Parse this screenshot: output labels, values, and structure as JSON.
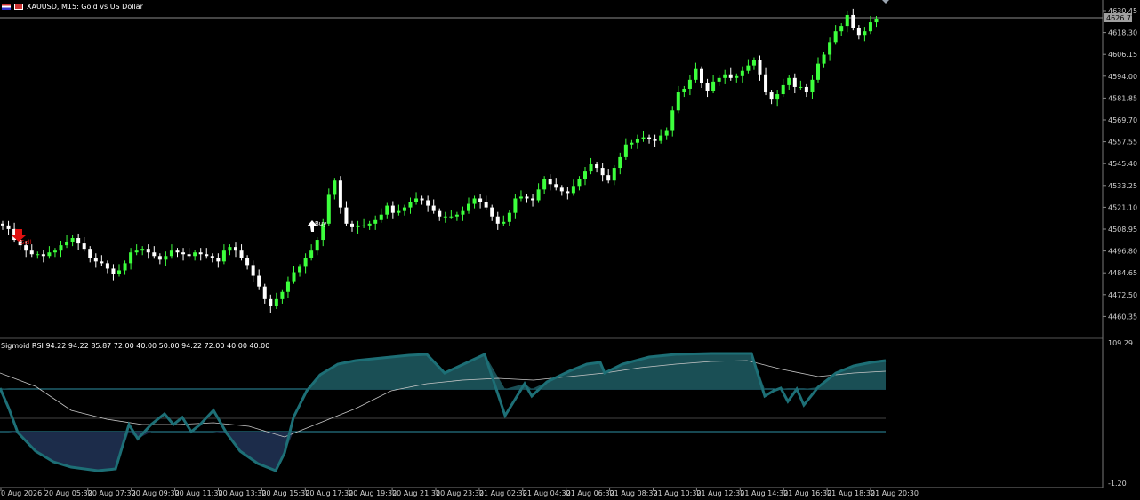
{
  "header": {
    "symbol_title": "XAUUSD, M15:  Gold vs US Dollar",
    "indicator_title": "Sigmoid RSI 94.22 94.22 85.87 72.00 40.00 50.00 94.22 72.00 40.00 40.00"
  },
  "colors": {
    "background": "#000000",
    "bull": "#3cff3c",
    "bear": "#ffffff",
    "rsi_line": "#1c6f74",
    "rsi_fill_up": "#1a4f55",
    "rsi_fill_down": "#1c2c4a",
    "level_line": "#2e8fa3",
    "signal_line": "#cccccc"
  },
  "price_axis": {
    "ticks": [
      "4630.45",
      "4618.30",
      "4606.15",
      "4594.00",
      "4581.85",
      "4569.70",
      "4557.55",
      "4545.40",
      "4533.25",
      "4521.10",
      "4508.95",
      "4496.80",
      "4484.65",
      "4472.50",
      "4460.35"
    ],
    "current": "4626.72"
  },
  "rsi_axis": {
    "top": "109.29",
    "bottom": "-1.20"
  },
  "time_axis": {
    "labels": [
      "0 Aug 2026",
      "20 Aug 05:30",
      "20 Aug 07:30",
      "20 Aug 09:30",
      "20 Aug 11:30",
      "20 Aug 13:30",
      "20 Aug 15:30",
      "20 Aug 17:30",
      "20 Aug 19:30",
      "20 Aug 21:30",
      "20 Aug 23:30",
      "21 Aug 02:30",
      "21 Aug 04:30",
      "21 Aug 06:30",
      "21 Aug 08:30",
      "21 Aug 10:30",
      "21 Aug 12:30",
      "21 Aug 14:30",
      "21 Aug 16:30",
      "21 Aug 18:30",
      "21 Aug 20:30"
    ]
  },
  "markers": {
    "sell_label": "Sell",
    "buy_label": "Buy"
  },
  "chart_data": {
    "type": "candlestick",
    "closes": [
      4511,
      4509,
      4503,
      4500,
      4497,
      4495,
      4495,
      4494,
      4496,
      4497,
      4500,
      4502,
      4504,
      4501,
      4498,
      4493,
      4491,
      4490,
      4487,
      4484,
      4486,
      4490,
      4496,
      4497,
      4498,
      4496,
      4494,
      4492,
      4494,
      4497,
      4496,
      4495,
      4494,
      4496,
      4495,
      4494,
      4493,
      4491,
      4497,
      4499,
      4497,
      4493,
      4489,
      4483,
      4477,
      4470,
      4466,
      4470,
      4474,
      4480,
      4485,
      4488,
      4493,
      4497,
      4503,
      4512,
      4528,
      4536,
      4521,
      4512,
      4510,
      4511,
      4511,
      4512,
      4514,
      4517,
      4522,
      4518,
      4519,
      4521,
      4524,
      4526,
      4525,
      4522,
      4519,
      4516,
      4516,
      4516,
      4517,
      4519,
      4523,
      4526,
      4524,
      4521,
      4516,
      4512,
      4513,
      4518,
      4526,
      4527,
      4526,
      4525,
      4531,
      4537,
      4534,
      4532,
      4530,
      4529,
      4533,
      4537,
      4541,
      4545,
      4543,
      4539,
      4536,
      4543,
      4549,
      4556,
      4557,
      4559,
      4560,
      4559,
      4558,
      4561,
      4564,
      4575,
      4585,
      4587,
      4592,
      4598,
      4590,
      4586,
      4591,
      4593,
      4595,
      4593,
      4594,
      4597,
      4600,
      4603,
      4595,
      4585,
      4581,
      4584,
      4589,
      4593,
      4588,
      4588,
      4585,
      4592,
      4601,
      4606,
      4613,
      4619,
      4622,
      4628,
      4621,
      4617,
      4619,
      4624,
      4626
    ]
  }
}
